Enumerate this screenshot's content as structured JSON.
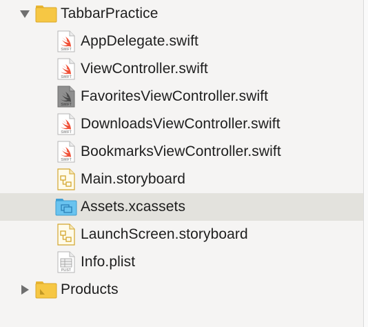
{
  "navigator": {
    "groups": [
      {
        "name": "TabbarPractice",
        "expanded": true,
        "children": [
          {
            "label": "AppDelegate.swift",
            "icon": "swift-file-icon"
          },
          {
            "label": "ViewController.swift",
            "icon": "swift-file-icon"
          },
          {
            "label": "FavoritesViewController.swift",
            "icon": "swift-file-icon-dimmed"
          },
          {
            "label": "DownloadsViewController.swift",
            "icon": "swift-file-icon"
          },
          {
            "label": "BookmarksViewController.swift",
            "icon": "swift-file-icon"
          },
          {
            "label": "Main.storyboard",
            "icon": "storyboard-file-icon"
          },
          {
            "label": "Assets.xcassets",
            "icon": "asset-catalog-icon",
            "selected": true
          },
          {
            "label": "LaunchScreen.storyboard",
            "icon": "storyboard-file-icon"
          },
          {
            "label": "Info.plist",
            "icon": "plist-file-icon"
          }
        ]
      },
      {
        "name": "Products",
        "expanded": false,
        "children": []
      }
    ]
  },
  "colors": {
    "folder_yellow": "#f6c744",
    "selection_bg": "#e3e2dd",
    "swift_orange": "#f05138",
    "asset_blue": "#5ab8e8"
  }
}
